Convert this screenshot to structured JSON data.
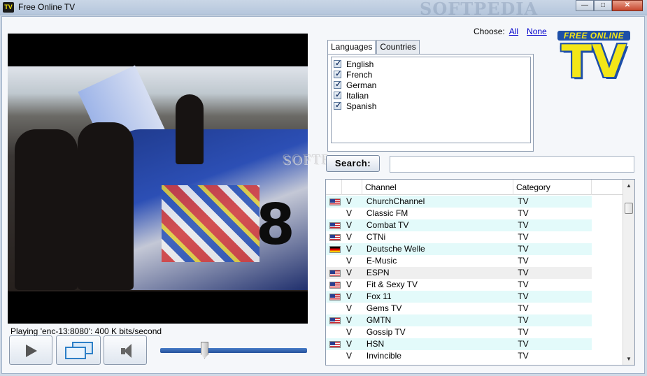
{
  "window": {
    "title": "Free Online TV",
    "app_icon_text": "TV",
    "watermark": "SOFTPEDIA",
    "min_glyph": "—",
    "max_glyph": "□",
    "close_glyph": "✕"
  },
  "player": {
    "status": "Playing 'enc-13:8080': 400 K bits/second",
    "volume_level": 0.3,
    "video_watermark": "SOFTPE"
  },
  "choose": {
    "label": "Choose:",
    "all": "All",
    "none": "None"
  },
  "logo": {
    "top_text": "FREE ONLINE",
    "main_text": "TV"
  },
  "tabs": [
    {
      "label": "Languages",
      "active": true
    },
    {
      "label": "Countries",
      "active": false
    }
  ],
  "languages": [
    {
      "label": "English",
      "checked": true
    },
    {
      "label": "French",
      "checked": true
    },
    {
      "label": "German",
      "checked": true
    },
    {
      "label": "Italian",
      "checked": true
    },
    {
      "label": "Spanish",
      "checked": true
    }
  ],
  "search": {
    "button_label": "Search:",
    "value": "",
    "watermark": "SOFTP"
  },
  "table": {
    "headers": {
      "flag": "",
      "v": "",
      "channel": "Channel",
      "category": "Category"
    },
    "rows": [
      {
        "flag": "us",
        "v": "V",
        "channel": "ChurchChannel",
        "category": "TV"
      },
      {
        "flag": "",
        "v": "V",
        "channel": "Classic FM",
        "category": "TV"
      },
      {
        "flag": "us",
        "v": "V",
        "channel": "Combat TV",
        "category": "TV"
      },
      {
        "flag": "us",
        "v": "V",
        "channel": "CTNi",
        "category": "TV"
      },
      {
        "flag": "de",
        "v": "V",
        "channel": "Deutsche Welle",
        "category": "TV"
      },
      {
        "flag": "",
        "v": "V",
        "channel": "E-Music",
        "category": "TV"
      },
      {
        "flag": "us",
        "v": "V",
        "channel": "ESPN",
        "category": "TV"
      },
      {
        "flag": "us",
        "v": "V",
        "channel": "Fit & Sexy TV",
        "category": "TV"
      },
      {
        "flag": "us",
        "v": "V",
        "channel": "Fox 11",
        "category": "TV"
      },
      {
        "flag": "",
        "v": "V",
        "channel": "Gems TV",
        "category": "TV"
      },
      {
        "flag": "us",
        "v": "V",
        "channel": "GMTN",
        "category": "TV"
      },
      {
        "flag": "",
        "v": "V",
        "channel": "Gossip TV",
        "category": "TV"
      },
      {
        "flag": "us",
        "v": "V",
        "channel": "HSN",
        "category": "TV"
      },
      {
        "flag": "",
        "v": "V",
        "channel": "Invincible",
        "category": "TV"
      }
    ],
    "selected_index": 6
  },
  "colors": {
    "row_alt": "#e3fafa",
    "logo_yellow": "#f3e617",
    "logo_blue": "#1d4fa8",
    "volume_blue": "#24519c"
  }
}
